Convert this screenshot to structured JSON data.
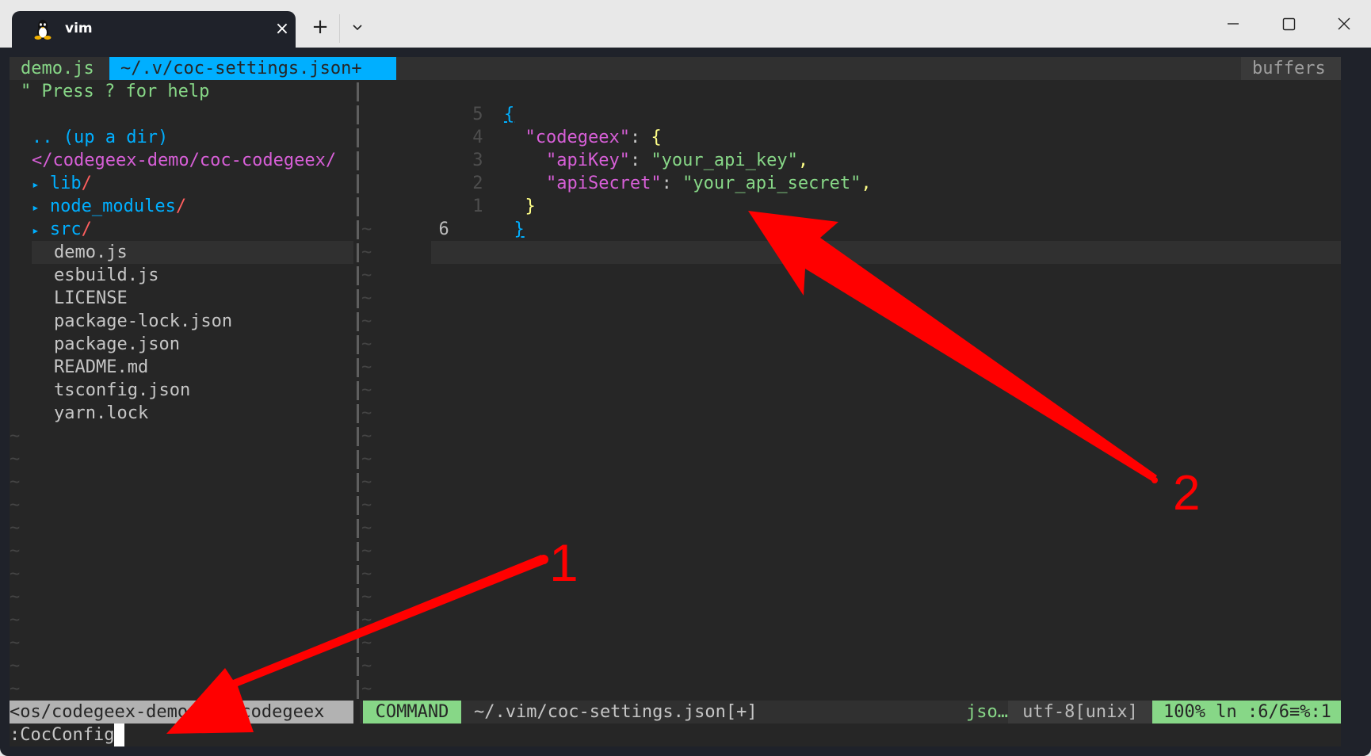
{
  "window": {
    "tab_title": "vim",
    "tab_icon": "linux-tux-icon",
    "new_tab_label": "+",
    "close_tab_label": "×"
  },
  "vim": {
    "tabline": {
      "tabs": [
        {
          "label": "demo.js",
          "active": false
        },
        {
          "label": "~/.v/coc-settings.json+",
          "active": true
        }
      ],
      "right_label": "buffers"
    },
    "nerdtree": {
      "help": "\" Press ? for help",
      "up_dir": ".. (up a dir)",
      "root": "</codegeex-demo/coc-codegeex/",
      "dirs": [
        {
          "arrow": "▸",
          "name": "lib",
          "slash": "/"
        },
        {
          "arrow": "▸",
          "name": "node_modules",
          "slash": "/"
        },
        {
          "arrow": "▸",
          "name": "src",
          "slash": "/"
        }
      ],
      "files": [
        "demo.js",
        "esbuild.js",
        "LICENSE",
        "package-lock.json",
        "package.json",
        "README.md",
        "tsconfig.json",
        "yarn.lock"
      ],
      "selected_file": "demo.js"
    },
    "editor": {
      "lines": [
        {
          "num": "5",
          "indent": "",
          "key": "",
          "open": "{",
          "value": "",
          "comma": "",
          "brace_color": "blue"
        },
        {
          "num": "4",
          "indent": "  ",
          "key": "\"codegeex\"",
          "colon": ": ",
          "open": "{",
          "value": "",
          "comma": ""
        },
        {
          "num": "3",
          "indent": "    ",
          "key": "\"apiKey\"",
          "colon": ": ",
          "value": "\"your_api_key\"",
          "comma": ","
        },
        {
          "num": "2",
          "indent": "    ",
          "key": "\"apiSecret\"",
          "colon": ": ",
          "value": "\"your_api_secret\"",
          "comma": ","
        },
        {
          "num": "1",
          "indent": "  ",
          "close": "}"
        },
        {
          "num": "6",
          "indent": "",
          "close": "}",
          "current": true
        }
      ],
      "tilde": "~"
    },
    "statusline": {
      "left_path": "<os/codegeex-demo/coc-codegeex",
      "mode": "COMMAND",
      "file": "~/.vim/coc-settings.json[+]",
      "filetype": "jso…",
      "encoding": "utf-8[unix]",
      "percent": "100%",
      "position": "ln :6/6≡%:1"
    },
    "cmdline": ":CocConfig"
  },
  "annotations": [
    {
      "label": "1",
      "target": "cmdline"
    },
    {
      "label": "2",
      "target": "editor-line-6"
    }
  ],
  "colors": {
    "accent_blue": "#00afff",
    "mode_green": "#87d787",
    "annotation_red": "#ff0000"
  }
}
